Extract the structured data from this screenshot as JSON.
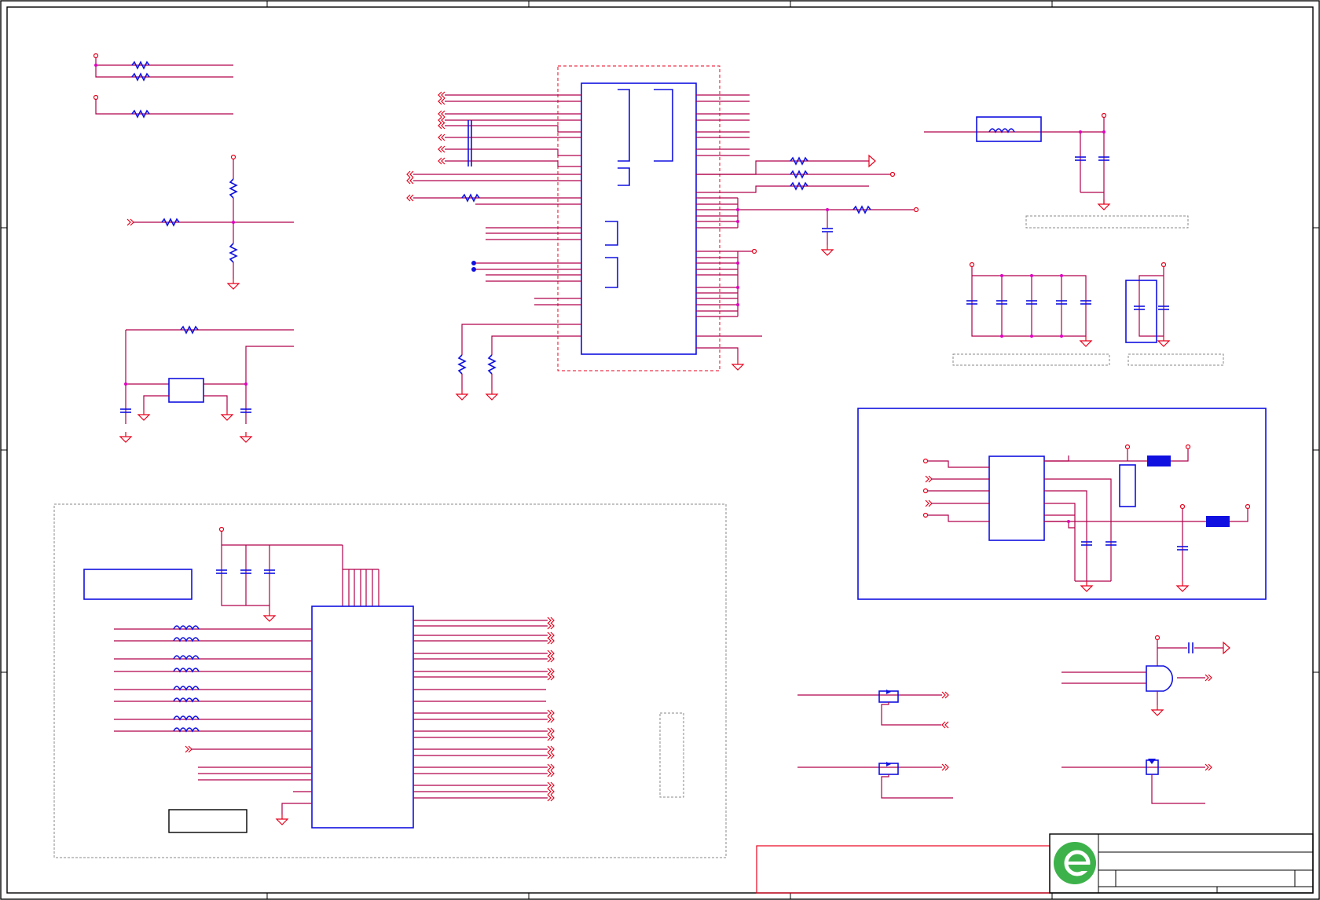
{
  "colors": {
    "wire": "#b0004a",
    "net_port": "#e8001c",
    "component": "#1010e0",
    "junction": "#e000c0",
    "logo_green": "#3db24a",
    "frame": "#000000"
  },
  "icons": {
    "logo": "company-logo-icon",
    "resistor": "resistor-icon",
    "capacitor": "capacitor-icon",
    "inductor": "inductor-icon",
    "ground": "ground-icon",
    "mosfet": "mosfet-icon",
    "and_gate": "and-gate-icon"
  }
}
